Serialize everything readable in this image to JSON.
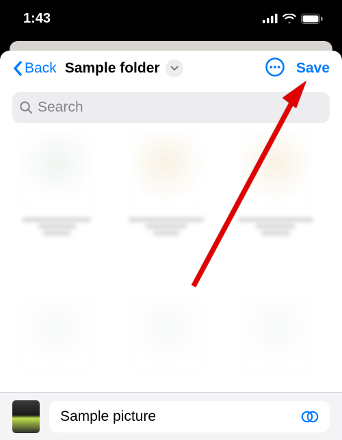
{
  "status": {
    "time": "1:43"
  },
  "nav": {
    "back_label": "Back",
    "title": "Sample folder",
    "save_label": "Save"
  },
  "search": {
    "placeholder": "Search"
  },
  "bottom": {
    "caption": "Sample picture"
  }
}
